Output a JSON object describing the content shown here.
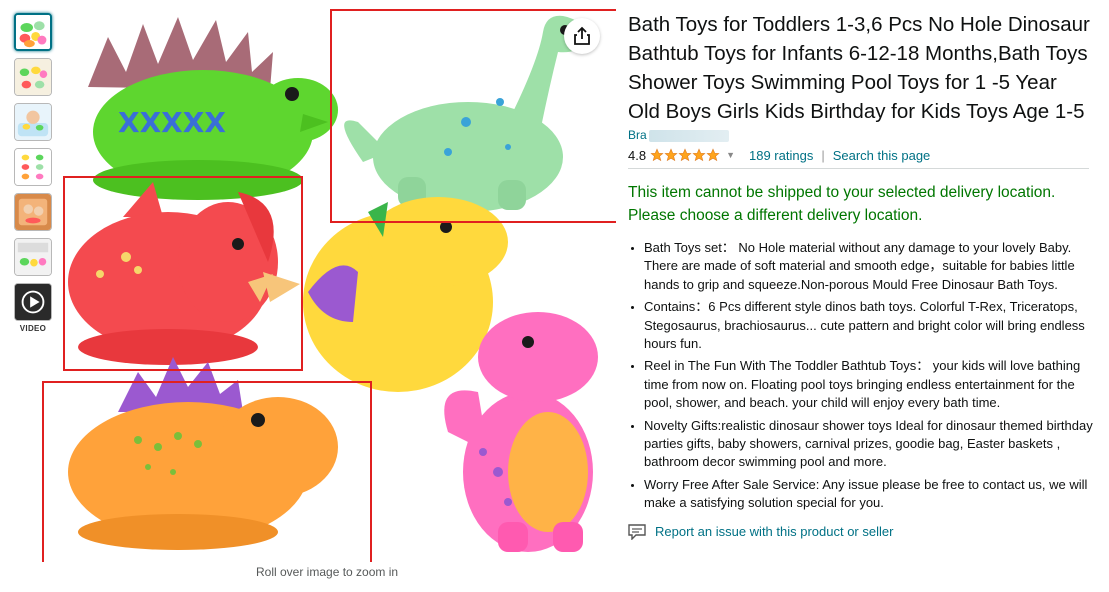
{
  "thumbnails": [
    {
      "name": "thumb-1"
    },
    {
      "name": "thumb-2"
    },
    {
      "name": "thumb-3"
    },
    {
      "name": "thumb-4"
    },
    {
      "name": "thumb-5"
    },
    {
      "name": "thumb-6"
    }
  ],
  "video_label": "VIDEO",
  "zoom_hint": "Roll over image to zoom in",
  "product": {
    "title": "Bath Toys for Toddlers 1-3,6 Pcs No Hole Dinosaur Bathtub Toys for Infants 6-12-18 Months,Bath Toys Shower Toys Swimming Pool Toys for 1 -5 Year Old Boys Girls Kids Birthday for Kids Toys Age 1-5",
    "brand_prefix": "Bra",
    "rating": "4.8",
    "ratings_link": "189 ratings",
    "search_link": "Search this page",
    "ship_warning": "This item cannot be shipped to your selected delivery location. Please choose a different delivery location.",
    "bullets": [
      "Bath Toys set： No Hole material without any damage to your lovely Baby. There are made of soft material and smooth edge，suitable for babies little hands to grip and squeeze.Non-porous Mould Free Dinosaur Bath Toys.",
      "Contains：6 Pcs different style dinos bath toys. Colorful T-Rex, Triceratops, Stegosaurus, brachiosaurus... cute pattern and bright color will bring endless hours fun.",
      "Reel in The Fun With The Toddler Bathtub Toys： your kids will love bathing time from now on. Floating pool toys bringing endless entertainment for the pool, shower, and beach. your child will enjoy every bath time.",
      "Novelty Gifts:realistic dinosaur shower toys Ideal for dinosaur themed birthday parties gifts, baby showers, carnival prizes, goodie bag, Easter baskets , bathroom decor swimming pool and more.",
      "Worry Free After Sale Service: Any issue please be free to contact us, we will make a satisfying solution special for you."
    ],
    "report_link": "Report an issue with this product or seller"
  },
  "colors": {
    "link": "#007185",
    "ship_warning": "#007600",
    "star": "#ffa41c",
    "highlight_box": "#e02020"
  }
}
